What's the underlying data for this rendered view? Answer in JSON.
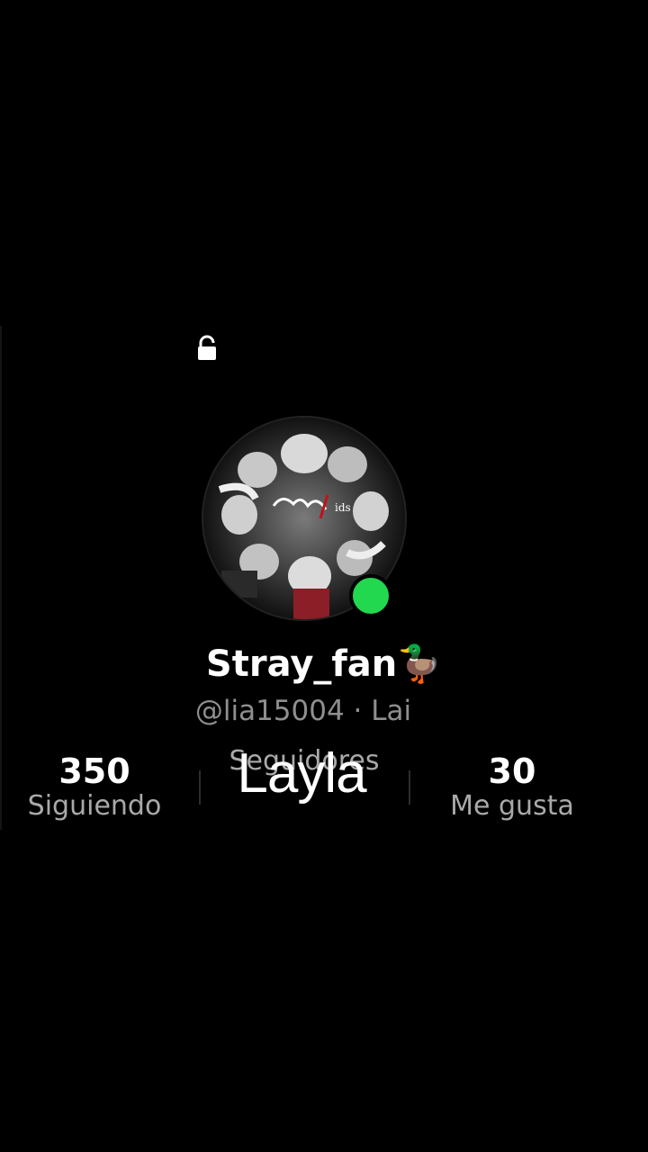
{
  "profile": {
    "display_name": "Stray_fan🦆",
    "handle_line": "@lia15004 · Lai",
    "online": true,
    "accent_online_color": "#22d84f"
  },
  "stats": {
    "following": {
      "value": "350",
      "label": "Siguiendo"
    },
    "followers": {
      "value": "",
      "label": "Seguidores"
    },
    "likes": {
      "value": "30",
      "label": "Me gusta"
    }
  },
  "overlay": {
    "caption": "Layla"
  },
  "icons": {
    "lock": "lock-icon"
  },
  "colors": {
    "background": "#000000",
    "text_primary": "#ffffff",
    "text_secondary": "#8f8f8f"
  }
}
